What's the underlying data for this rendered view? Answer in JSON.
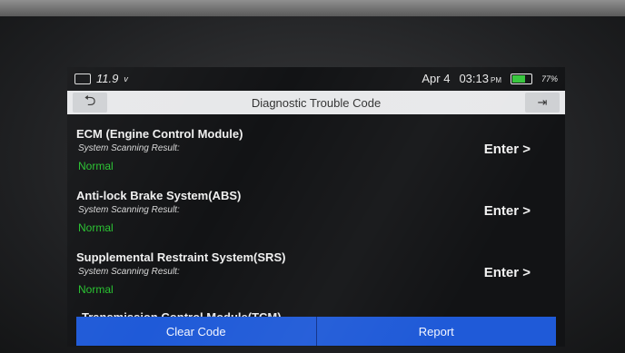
{
  "status": {
    "voltage": "11.9",
    "voltage_unit": "v",
    "date": "Apr 4",
    "time": "03:13",
    "ampm": "PM",
    "battery": "77%"
  },
  "header": {
    "title": "Diagnostic Trouble Code",
    "back_icon": "back-arrow-icon",
    "exit_icon": "exit-icon"
  },
  "systems": [
    {
      "name": "ECM (Engine Control Module)",
      "label": "System Scanning Result:",
      "result": "Normal",
      "action": "Enter >"
    },
    {
      "name": "Anti-lock Brake System(ABS)",
      "label": "System Scanning Result:",
      "result": "Normal",
      "action": "Enter >"
    },
    {
      "name": "Supplemental Restraint System(SRS)",
      "label": "System Scanning Result:",
      "result": "Normal",
      "action": "Enter >"
    }
  ],
  "partial_item": "Transmission Control Module(TCM)",
  "footer": {
    "clear_code": "Clear Code",
    "report": "Report"
  },
  "colors": {
    "normal": "#27c22f",
    "footer_button": "#1f5ad8",
    "header_bg": "#e7e8ea"
  }
}
